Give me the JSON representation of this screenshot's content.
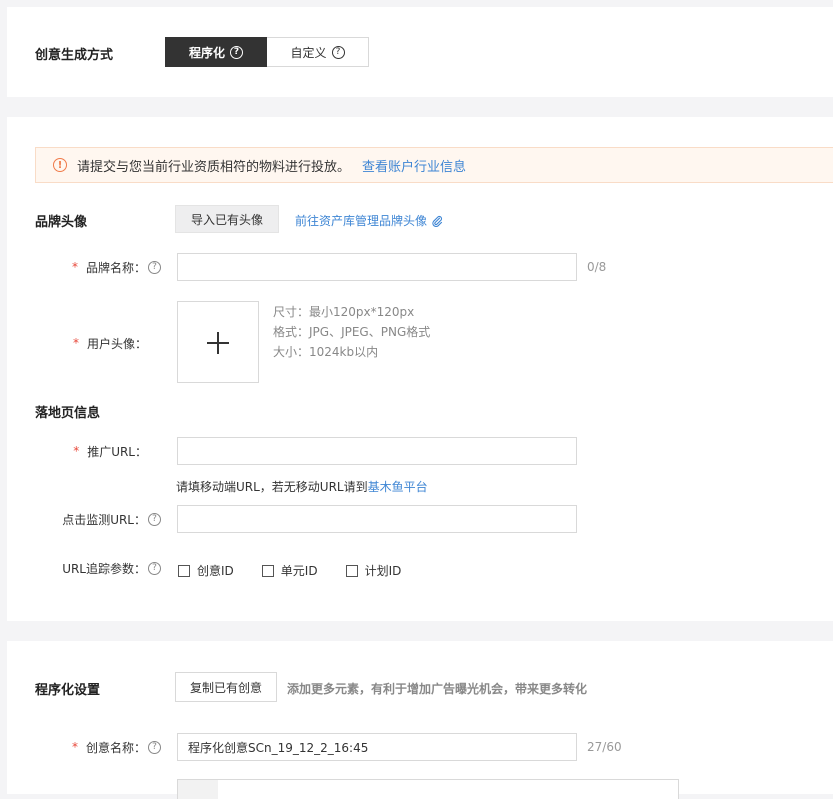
{
  "generation": {
    "title": "创意生成方式",
    "options": [
      {
        "label": "程序化",
        "active": true
      },
      {
        "label": "自定义",
        "active": false
      }
    ]
  },
  "alert": {
    "message": "请提交与您当前行业资质相符的物料进行投放。",
    "link": "查看账户行业信息",
    "icon": "!"
  },
  "brand": {
    "title": "品牌头像",
    "import_button": "导入已有头像",
    "manage_link": "前往资产库管理品牌头像",
    "name_label": "品牌名称：",
    "name_value": "",
    "name_counter": "0/8",
    "avatar_label": "用户头像：",
    "specs": [
      "尺寸：最小120px*120px",
      "格式：JPG、JPEG、PNG格式",
      "大小：1024kb以内"
    ]
  },
  "landing": {
    "title": "落地页信息",
    "url_label": "推广URL：",
    "url_value": "",
    "url_hint_prefix": "请填移动端URL，若无移动URL请到",
    "url_hint_link": "基木鱼平台",
    "monitor_label": "点击监测URL：",
    "monitor_value": "",
    "tracking_label": "URL追踪参数：",
    "tracking_options": [
      "创意ID",
      "单元ID",
      "计划ID"
    ]
  },
  "programmatic": {
    "title": "程序化设置",
    "copy_button": "复制已有创意",
    "hint": "添加更多元素，有利于增加广告曝光机会，带来更多转化",
    "creative_name_label": "创意名称：",
    "creative_name_value": "程序化创意SCn_19_12_2_16:45",
    "creative_name_counter": "27/60"
  },
  "colors": {
    "accent_dark": "#333333",
    "link": "#3f86d4",
    "required": "#e8483a",
    "alert_icon": "#f07b4a"
  },
  "icons": {
    "help": "?",
    "attach": "paperclip-icon",
    "upload": "+"
  }
}
